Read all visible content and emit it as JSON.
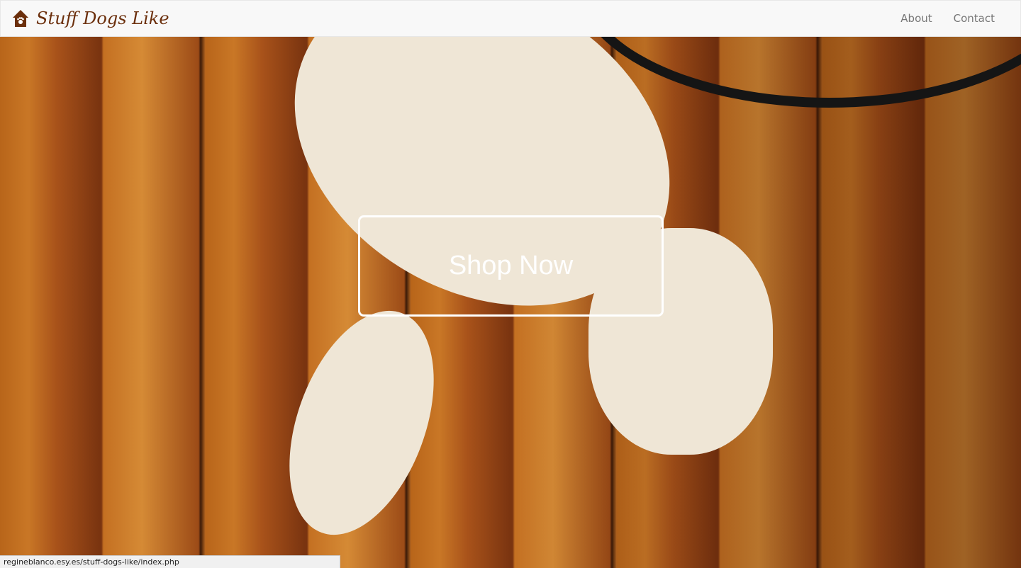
{
  "navbar": {
    "brand": "Stuff Dogs Like",
    "links": [
      "About",
      "Contact"
    ]
  },
  "hero": {
    "cta_label": "Shop Now"
  },
  "status_bar": {
    "url": "regineblanco.esy.es/stuff-dogs-like/index.php"
  },
  "colors": {
    "brand": "#6b2f0c",
    "nav_bg": "#f8f8f8",
    "link": "#777777"
  }
}
